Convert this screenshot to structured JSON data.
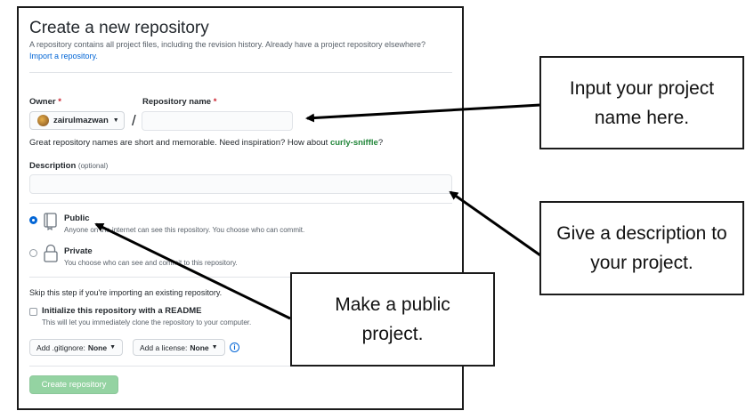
{
  "form": {
    "title": "Create a new repository",
    "subtitle_main": "A repository contains all project files, including the revision history. Already have a project repository elsewhere?",
    "subtitle_link": "Import a repository.",
    "owner_label": "Owner",
    "repo_label": "Repository name",
    "required_mark": "*",
    "owner_value": "zairulmazwan",
    "slash": "/",
    "repo_name_value": "",
    "hint_prefix": "Great repository names are short and memorable. Need inspiration? How about",
    "hint_suggestion": "curly-sniffle",
    "hint_suffix": "?",
    "description_label": "Description",
    "description_optional": "(optional)",
    "description_value": "",
    "visibility": {
      "public_title": "Public",
      "public_desc": "Anyone on the internet can see this repository. You choose who can commit.",
      "private_title": "Private",
      "private_desc": "You choose who can see and commit to this repository.",
      "selected": "public"
    },
    "skip_text": "Skip this step if you're importing an existing repository.",
    "readme_label": "Initialize this repository with a README",
    "readme_desc": "This will let you immediately clone the repository to your computer.",
    "gitignore_prefix": "Add .gitignore:",
    "gitignore_value": "None",
    "license_prefix": "Add a license:",
    "license_value": "None",
    "info_glyph": "i",
    "create_button": "Create repository"
  },
  "callouts": {
    "name": "Input your project name here.",
    "description": "Give a description to your project.",
    "public": "Make a public project."
  }
}
